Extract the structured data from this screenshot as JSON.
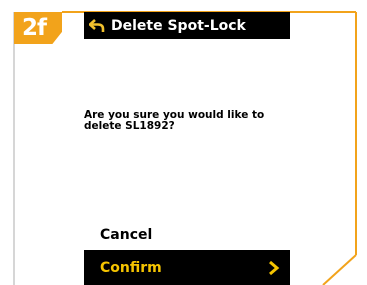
{
  "step": {
    "label": "2f"
  },
  "header": {
    "title": "Delete Spot-Lock",
    "back_icon": "back-arrow-icon"
  },
  "dialog": {
    "message": "Are you sure you would like to delete SL1892?"
  },
  "actions": {
    "cancel_label": "Cancel",
    "confirm_label": "Confirm",
    "confirm_icon": "chevron-right-icon"
  },
  "colors": {
    "accent": "#f2a31b",
    "confirm_text": "#f5c400",
    "bar": "#000000"
  }
}
